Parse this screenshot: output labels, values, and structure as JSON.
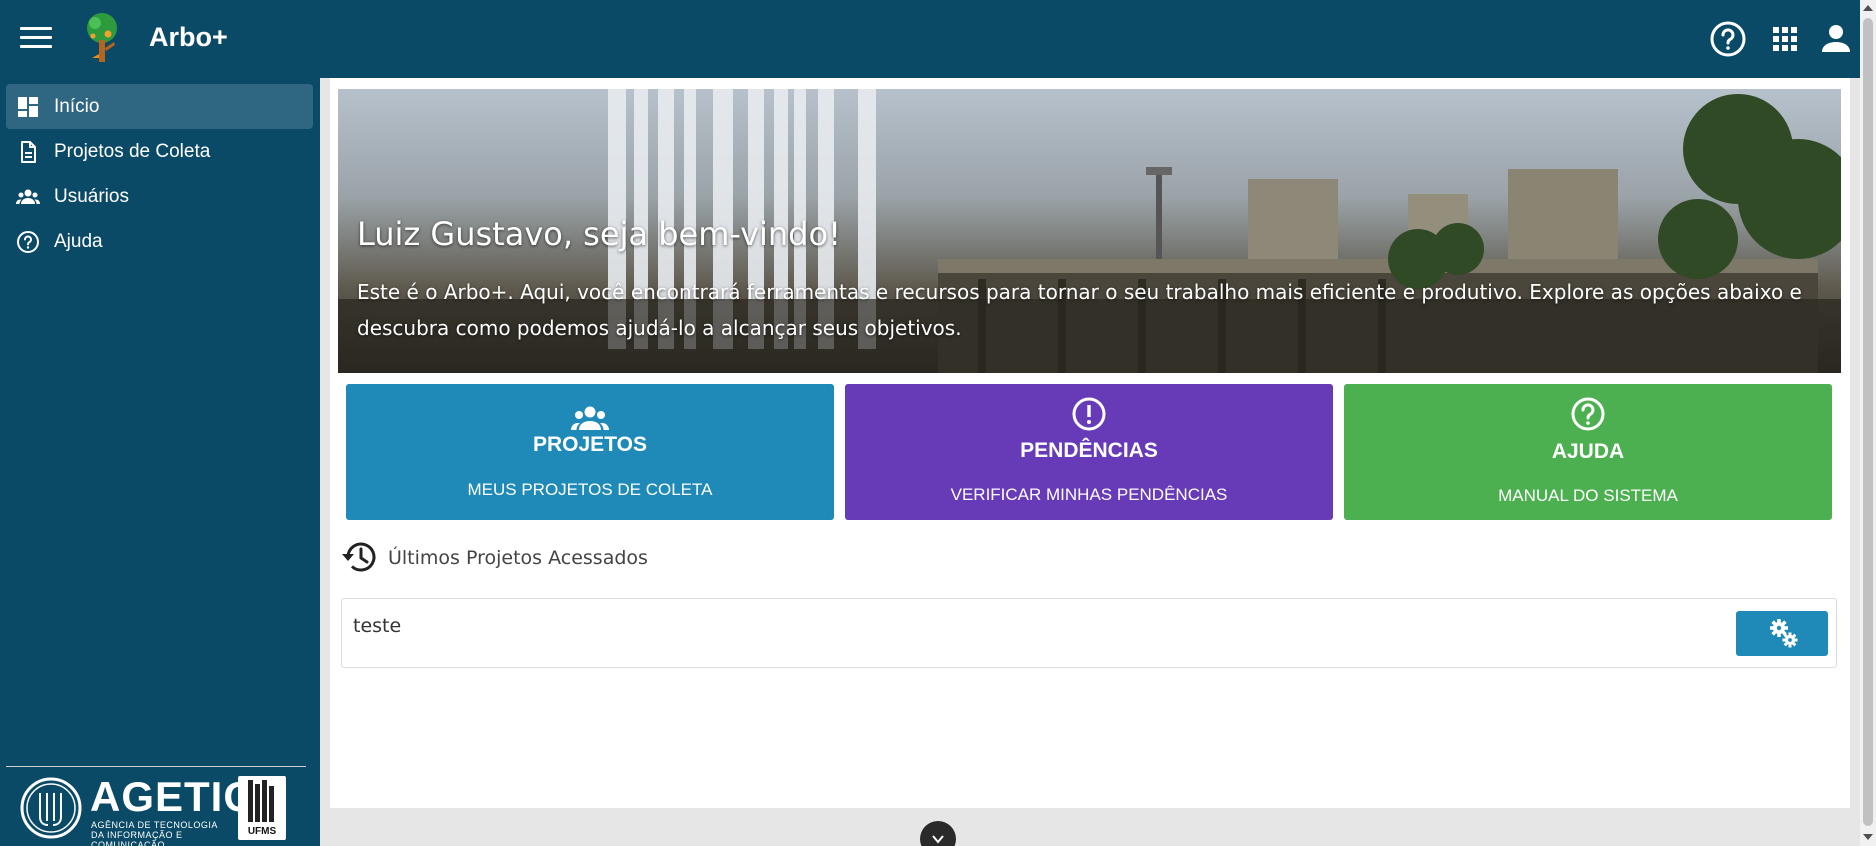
{
  "app": {
    "title": "Arbo+"
  },
  "sidebar": {
    "items": [
      {
        "label": "Início",
        "icon": "dashboard-icon",
        "active": true
      },
      {
        "label": "Projetos de Coleta",
        "icon": "document-icon",
        "active": false
      },
      {
        "label": "Usuários",
        "icon": "users-icon",
        "active": false
      },
      {
        "label": "Ajuda",
        "icon": "help-circle-icon",
        "active": false
      }
    ],
    "footer": {
      "agetic_name": "AGETIC",
      "agetic_subtitle": "AGÊNCIA DE TECNOLOGIA DA INFORMAÇÃO E COMUNICAÇÃO",
      "ufms_label": "UFMS"
    }
  },
  "header": {
    "icons": [
      "help-circle-icon",
      "apps-grid-icon",
      "account-icon"
    ]
  },
  "hero": {
    "title": "Luiz Gustavo, seja bem-vindo!",
    "description": "Este é o Arbo+. Aqui, você encontrará ferramentas e recursos para tornar o seu trabalho mais eficiente e produtivo. Explore as opções abaixo e descubra como podemos ajudá-lo a alcançar seus objetivos."
  },
  "tiles": [
    {
      "title": "PROJETOS",
      "subtitle": "MEUS PROJETOS DE COLETA",
      "icon": "group-icon",
      "color": "#1f8ab7"
    },
    {
      "title": "PENDÊNCIAS",
      "subtitle": "VERIFICAR MINHAS PENDÊNCIAS",
      "icon": "alert-circle-icon",
      "color": "#673ab7"
    },
    {
      "title": "AJUDA",
      "subtitle": "MANUAL DO SISTEMA",
      "icon": "help-circle-icon",
      "color": "#4caf50"
    }
  ],
  "recent": {
    "heading": "Últimos Projetos Acessados",
    "items": [
      {
        "name": "teste",
        "action_icon": "settings-gears-icon"
      }
    ]
  },
  "colors": {
    "brand": "#0b4a66",
    "sidebar_active": "#2f6783",
    "action_button": "#1f8ab7"
  }
}
